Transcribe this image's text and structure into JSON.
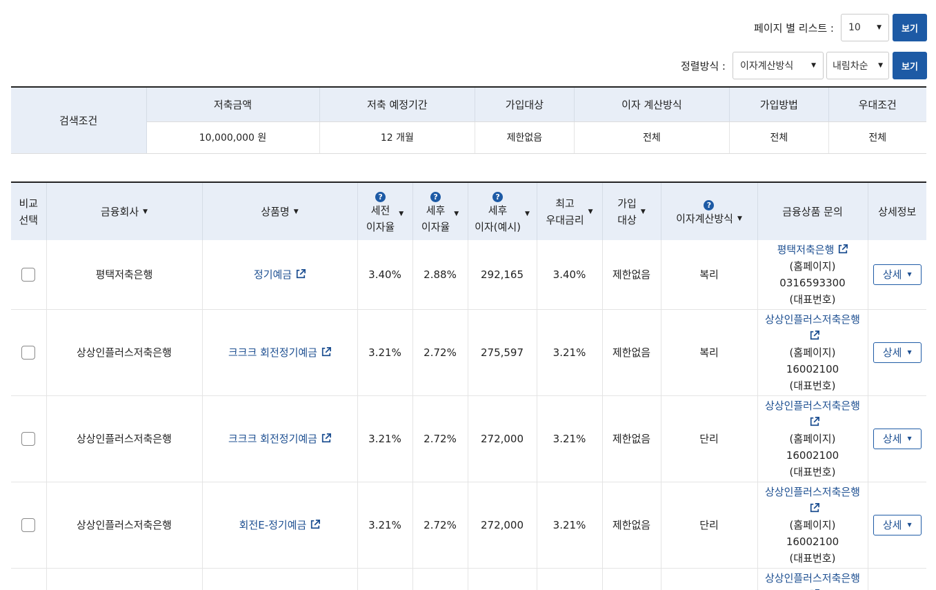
{
  "controls": {
    "per_page_label": "페이지 별 리스트 :",
    "per_page_value": "10",
    "view_button": "보기",
    "sort_label": "정렬방식 :",
    "sort_calc_value": "이자계산방식",
    "sort_order_value": "내림차순",
    "view_button2": "보기"
  },
  "condition": {
    "label": "검색조건",
    "headers": [
      "저축금액",
      "저축 예정기간",
      "가입대상",
      "이자 계산방식",
      "가입방법",
      "우대조건"
    ],
    "values": [
      "10,000,000 원",
      "12 개월",
      "제한없음",
      "전체",
      "전체",
      "전체"
    ]
  },
  "table": {
    "headers": {
      "compare_1": "비교",
      "compare_2": "선택",
      "company": "금융회사",
      "product": "상품명",
      "pretax_1": "세전",
      "pretax_2": "이자율",
      "aftertax_1": "세후",
      "aftertax_2": "이자율",
      "interest_1": "세후",
      "interest_2": "이자(예시)",
      "max_1": "최고",
      "max_2": "우대금리",
      "target_1": "가입",
      "target_2": "대상",
      "calc": "이자계산방식",
      "inquiry": "금융상품 문의",
      "detail": "상세정보"
    },
    "rows": [
      {
        "company": "평택저축은행",
        "product": "정기예금",
        "pretax": "3.40%",
        "aftertax": "2.88%",
        "interest": "292,165",
        "max": "3.40%",
        "target": "제한없음",
        "calc": "복리",
        "bank_link": "평택저축은행",
        "homepage": "(홈페이지)",
        "phone": "0316593300",
        "phone_label": "(대표번호)",
        "detail": "상세"
      },
      {
        "company": "상상인플러스저축은행",
        "product": "크크크 회전정기예금",
        "pretax": "3.21%",
        "aftertax": "2.72%",
        "interest": "275,597",
        "max": "3.21%",
        "target": "제한없음",
        "calc": "복리",
        "bank_link": "상상인플러스저축은행",
        "homepage": "(홈페이지)",
        "phone": "16002100",
        "phone_label": "(대표번호)",
        "detail": "상세"
      },
      {
        "company": "상상인플러스저축은행",
        "product": "크크크 회전정기예금",
        "pretax": "3.21%",
        "aftertax": "2.72%",
        "interest": "272,000",
        "max": "3.21%",
        "target": "제한없음",
        "calc": "단리",
        "bank_link": "상상인플러스저축은행",
        "homepage": "(홈페이지)",
        "phone": "16002100",
        "phone_label": "(대표번호)",
        "detail": "상세"
      },
      {
        "company": "상상인플러스저축은행",
        "product": "회전E-정기예금",
        "pretax": "3.21%",
        "aftertax": "2.72%",
        "interest": "272,000",
        "max": "3.21%",
        "target": "제한없음",
        "calc": "단리",
        "bank_link": "상상인플러스저축은행",
        "homepage": "(홈페이지)",
        "phone": "16002100",
        "phone_label": "(대표번호)",
        "detail": "상세"
      },
      {
        "company": "",
        "product": "",
        "pretax": "",
        "aftertax": "",
        "interest": "",
        "max": "",
        "target": "",
        "calc": "",
        "bank_link": "상상인플러스저축은행",
        "homepage": "",
        "phone": "",
        "phone_label": "",
        "detail": ""
      }
    ]
  },
  "icons": {
    "help": "question-circle-icon",
    "external": "external-link-icon",
    "caret": "caret-down-icon"
  },
  "colors": {
    "accent": "#1d5aa5",
    "header_bg": "#e8eef7",
    "link": "#1d4f91"
  }
}
